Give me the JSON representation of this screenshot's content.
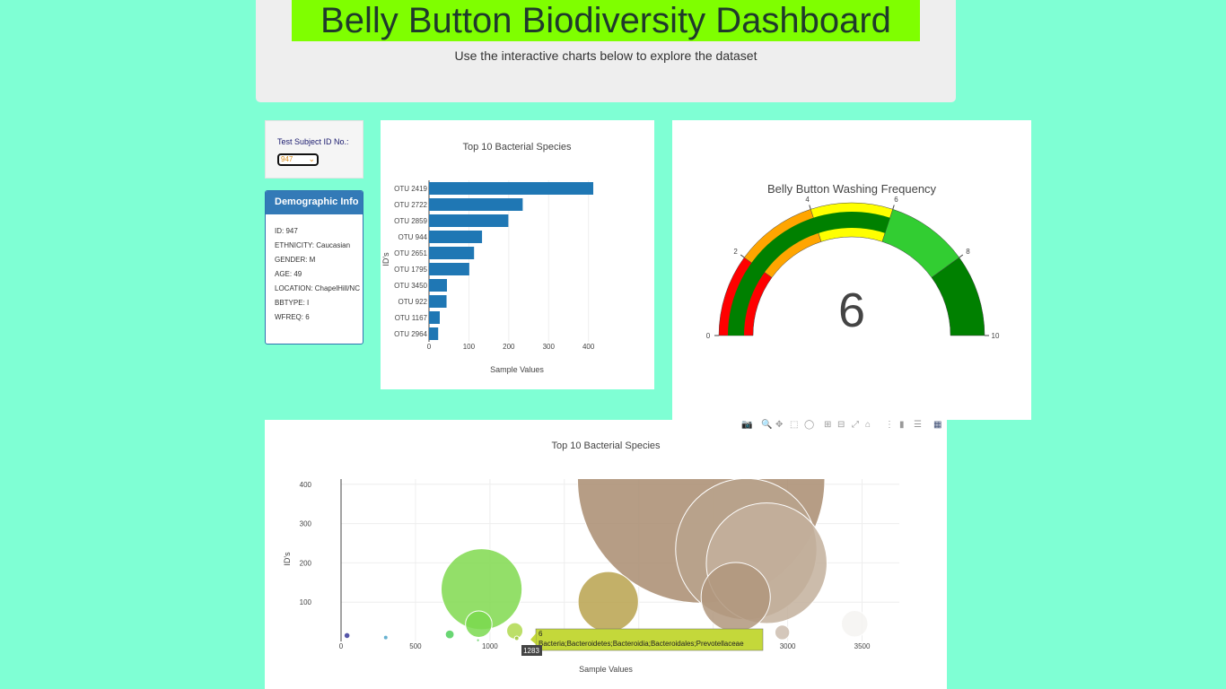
{
  "header": {
    "title": "Belly Button Biodiversity Dashboard",
    "subtitle": "Use the interactive charts below to explore the dataset"
  },
  "selector": {
    "label": "Test Subject ID No.:",
    "value": "947"
  },
  "demographics": {
    "heading": "Demographic Info",
    "rows": [
      "ID: 947",
      "ETHNICITY: Caucasian",
      "GENDER: M",
      "AGE: 49",
      "LOCATION: ChapelHill/NC",
      "BBTYPE: I",
      "WFREQ: 6"
    ]
  },
  "colors": {
    "background": "#7fffd4",
    "title_bg": "#7fff00",
    "bar": "#1f77b4",
    "panel_header": "#337ab7"
  },
  "modebar_icons": [
    "camera-icon",
    "zoom-icon",
    "pan-icon",
    "box-select-icon",
    "lasso-icon",
    "zoom-in-icon",
    "zoom-out-icon",
    "autoscale-icon",
    "reset-axes-icon",
    "spike-lines-icon",
    "hover-closest-icon",
    "hover-compare-icon",
    "plotly-logo-icon"
  ],
  "chart_data": [
    {
      "type": "bar",
      "orientation": "horizontal",
      "title": "Top 10 Bacterial Species",
      "xlabel": "Sample Values",
      "ylabel": "ID's",
      "categories": [
        "OTU 2419",
        "OTU 2722",
        "OTU 2859",
        "OTU 944",
        "OTU 2651",
        "OTU 1795",
        "OTU 3450",
        "OTU 922",
        "OTU 1167",
        "OTU 2964"
      ],
      "values": [
        412,
        235,
        199,
        133,
        113,
        101,
        45,
        44,
        27,
        23
      ],
      "xlim": [
        0,
        430
      ],
      "xticks": [
        0,
        100,
        200,
        300,
        400
      ]
    },
    {
      "type": "gauge",
      "title": "Belly Button Washing Frequency",
      "value": 6,
      "range": [
        0,
        10
      ],
      "ticks": [
        0,
        2,
        4,
        6,
        8,
        10
      ],
      "steps": [
        {
          "range": [
            0,
            2
          ],
          "color": "#ff0000"
        },
        {
          "range": [
            2,
            4
          ],
          "color": "#ffa500"
        },
        {
          "range": [
            4,
            6
          ],
          "color": "#ffff00"
        },
        {
          "range": [
            6,
            8
          ],
          "color": "#32cd32"
        },
        {
          "range": [
            8,
            10
          ],
          "color": "#008000"
        }
      ],
      "bar_color": "#008000"
    },
    {
      "type": "scatter",
      "mode": "bubble",
      "title": "Top 10 Bacterial Species",
      "xlabel": "Sample Values",
      "ylabel": "ID's",
      "xlim": [
        0,
        3750
      ],
      "ylim": [
        0,
        420
      ],
      "xticks": [
        0,
        500,
        1000,
        1500,
        2000,
        2500,
        3000,
        3500
      ],
      "yticks": [
        100,
        200,
        300,
        400
      ],
      "points": [
        {
          "x": 40,
          "y": 15,
          "size": 4,
          "color": "#3a3a9a"
        },
        {
          "x": 300,
          "y": 10,
          "size": 3,
          "color": "#4ba3c8"
        },
        {
          "x": 730,
          "y": 18,
          "size": 6,
          "color": "#4fcf5a"
        },
        {
          "x": 920,
          "y": 3,
          "size": 2,
          "color": "#6bd36b"
        },
        {
          "x": 925,
          "y": 44,
          "size": 18,
          "color": "#7ad94f"
        },
        {
          "x": 944,
          "y": 133,
          "size": 55,
          "color": "#80d94f"
        },
        {
          "x": 1167,
          "y": 27,
          "size": 11,
          "color": "#b0d94f"
        },
        {
          "x": 1180,
          "y": 8,
          "size": 3,
          "color": "#a0c840"
        },
        {
          "x": 1795,
          "y": 101,
          "size": 41,
          "color": "#b8a24e"
        },
        {
          "x": 2419,
          "y": 412,
          "size": 168,
          "color": "#a98c70"
        },
        {
          "x": 2651,
          "y": 113,
          "size": 47,
          "color": "#b0967c"
        },
        {
          "x": 2722,
          "y": 235,
          "size": 96,
          "color": "#b8a38c"
        },
        {
          "x": 2859,
          "y": 199,
          "size": 82,
          "color": "#c3b09c"
        },
        {
          "x": 2964,
          "y": 23,
          "size": 10,
          "color": "#cdbdaf"
        },
        {
          "x": 3450,
          "y": 45,
          "size": 18,
          "color": "#f5f3f1"
        }
      ],
      "tooltip": {
        "line1": "6",
        "line2": "Bacteria;Bacteroidetes;Bacteroidia;Bacteroidales;Prevotellaceae",
        "x_label": "1283"
      }
    }
  ]
}
